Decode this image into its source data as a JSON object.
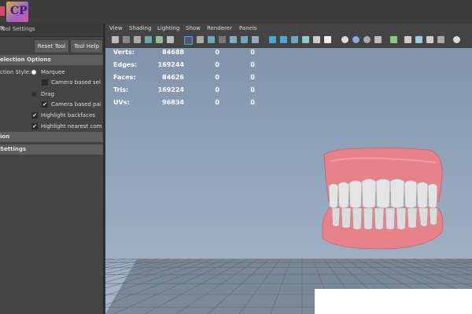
{
  "tool_settings": {
    "title": "Tool Settings",
    "reset_button": "Reset Tool",
    "help_button": "Tool Help",
    "sections": [
      "election Options",
      "ion",
      "Settings"
    ],
    "selection_style_label": "ction Style:",
    "options": [
      {
        "label": "Marquee",
        "kind": "radio",
        "selected": true
      },
      {
        "label": "Camera based sel",
        "kind": "checkbox",
        "checked": false
      },
      {
        "label": "Drag",
        "kind": "radio",
        "selected": false
      },
      {
        "label": "Camera based pai",
        "kind": "checkbox",
        "checked": true
      },
      {
        "label": "Highlight backfaces",
        "kind": "checkbox",
        "checked": true
      },
      {
        "label": "Highlight nearest com",
        "kind": "checkbox",
        "checked": true
      }
    ]
  },
  "viewport": {
    "menu": [
      "View",
      "Shading",
      "Lighting",
      "Show",
      "Renderer",
      "Panels"
    ],
    "stats": [
      {
        "label": "Verts:",
        "v1": "84688",
        "v2": "0",
        "v3": "0"
      },
      {
        "label": "Edges:",
        "v1": "169244",
        "v2": "0",
        "v3": "0"
      },
      {
        "label": "Faces:",
        "v1": "84626",
        "v2": "0",
        "v3": "0"
      },
      {
        "label": "Tris:",
        "v1": "169224",
        "v2": "0",
        "v3": "0"
      },
      {
        "label": "UVs:",
        "v1": "96834",
        "v2": "0",
        "v3": "0"
      }
    ]
  },
  "icons": [
    "pin-icon",
    "close-icon",
    "camera-icon",
    "grid-icon",
    "wireframe-icon",
    "shaded-icon",
    "texture-icon",
    "light-icon",
    "shadow-icon",
    "isolate-icon",
    "xray-icon"
  ],
  "colors": {
    "viewport_top": "#7d90a8",
    "viewport_bottom": "#a9b7c9",
    "gum": "#e8828a",
    "teeth": "#e2e2e2",
    "highlight": "#4aa8d8"
  }
}
